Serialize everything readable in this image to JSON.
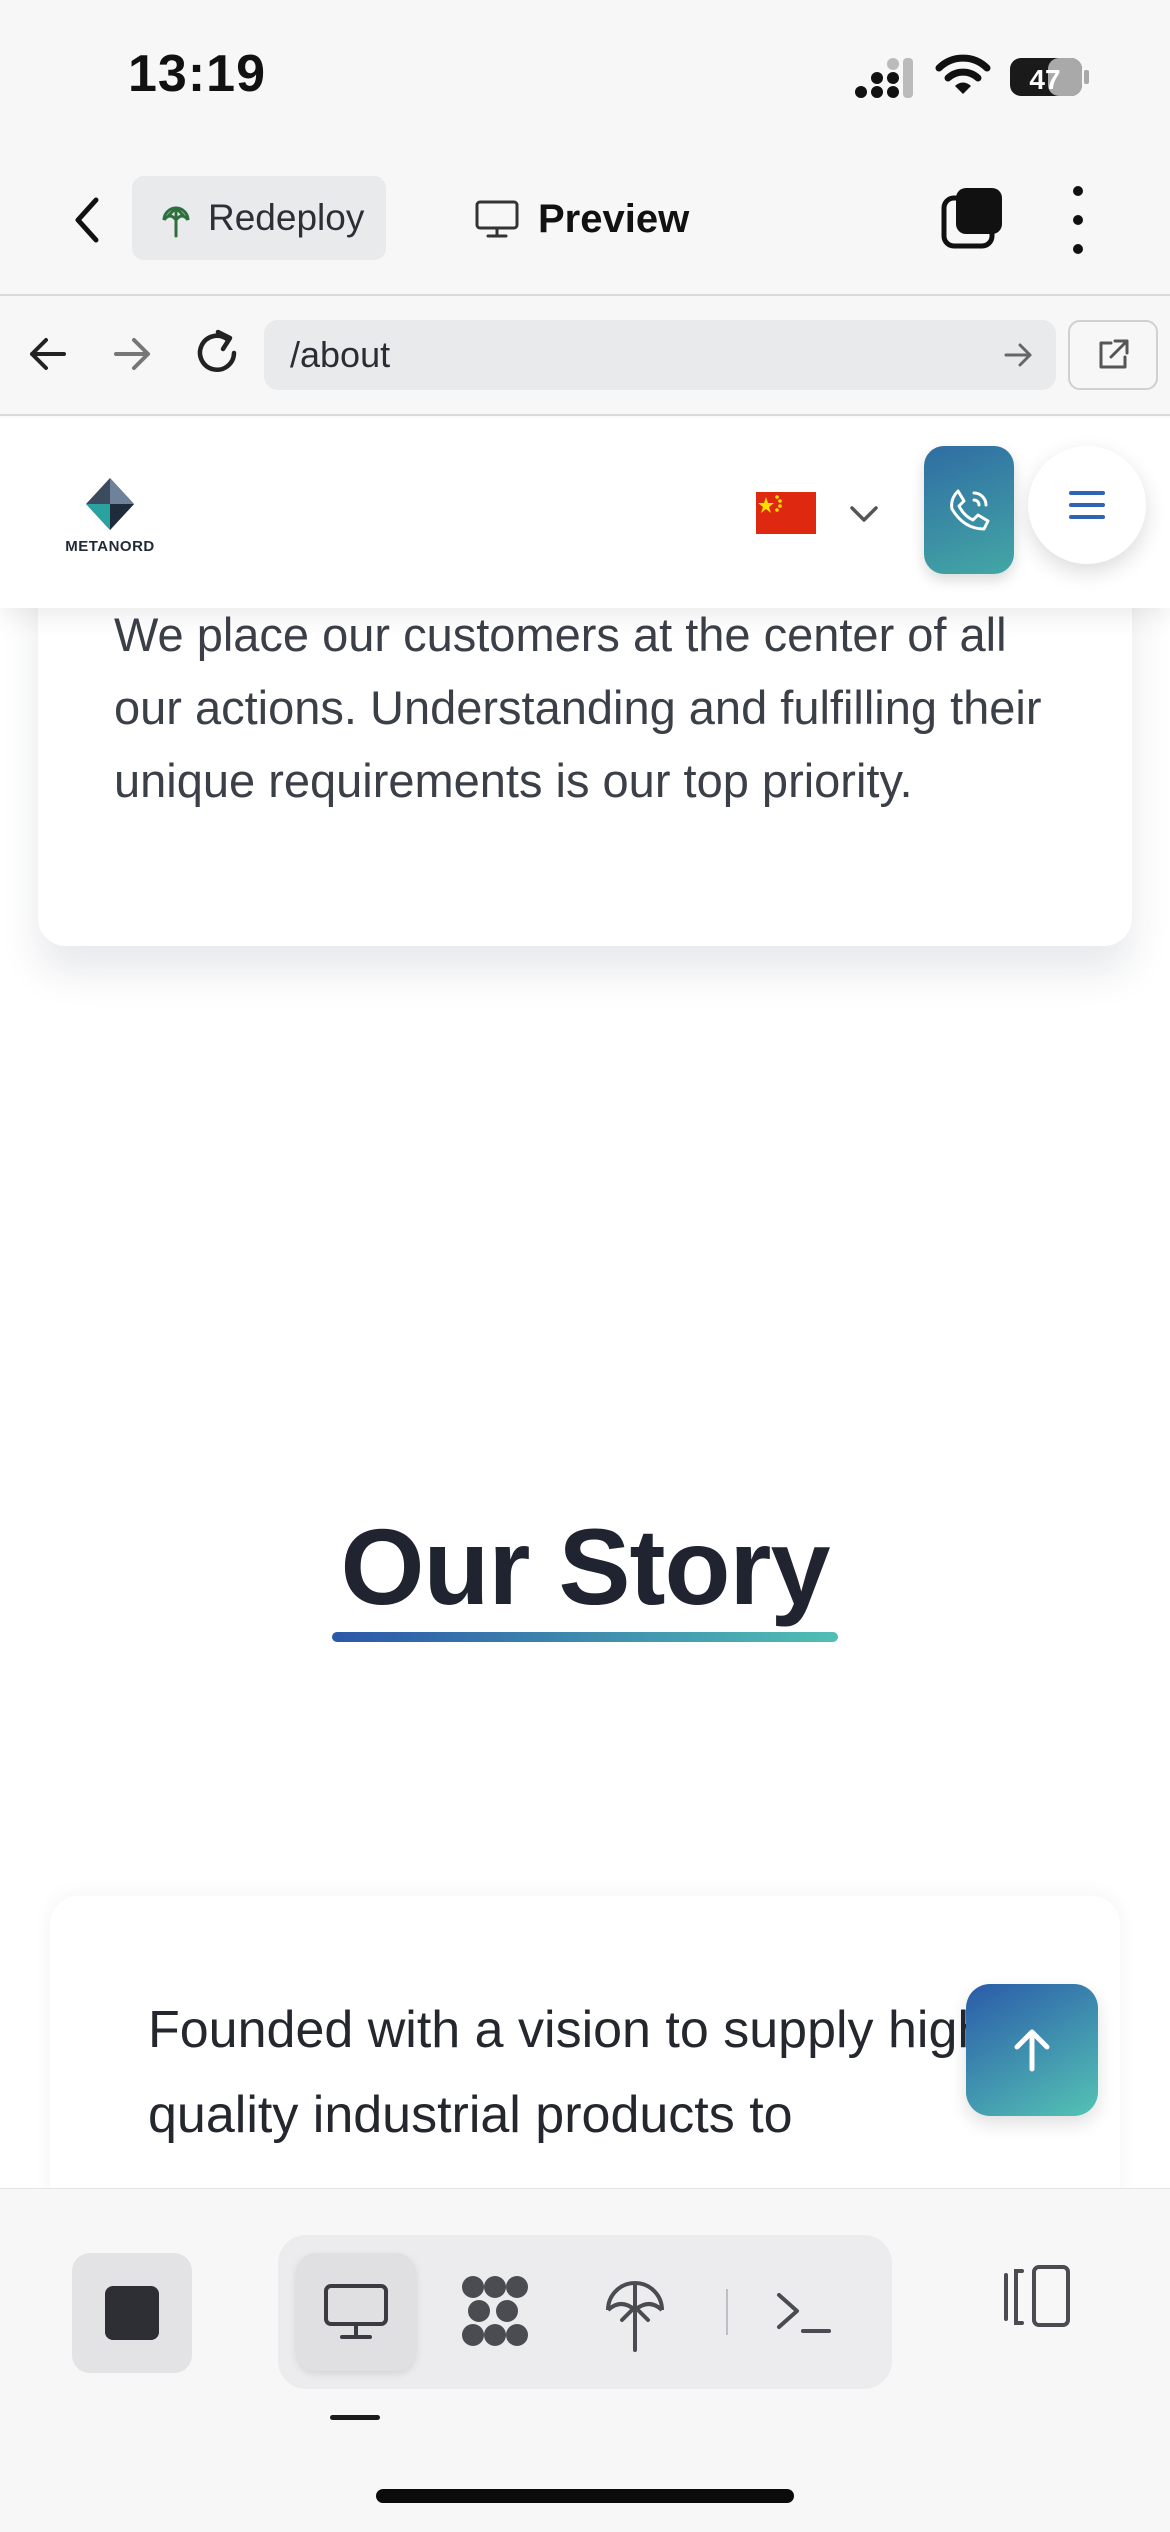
{
  "status_bar": {
    "time": "13:19",
    "battery": "47"
  },
  "toolbar": {
    "redeploy_label": "Redeploy",
    "preview_label": "Preview"
  },
  "browser": {
    "url": "/about"
  },
  "site": {
    "logo_text": "METANORD",
    "value_card_text": "We place our customers at the center of all our actions. Understanding and fulfilling their unique requirements is our top priority.",
    "story_title": "Our Story",
    "story_text": "Founded with a vision to supply high-quality industrial products to"
  },
  "colors": {
    "accent_blue": "#2c57a9",
    "accent_teal": "#4fbfb3",
    "flag_red": "#de2910",
    "flag_star": "#ffde00"
  },
  "icons": {
    "back": "chevron-left-icon",
    "redeploy": "redeploy-icon",
    "preview": "monitor-icon",
    "tabs": "tabs-icon",
    "more": "more-vertical-icon",
    "nav_back": "arrow-left-icon",
    "nav_forward": "arrow-right-icon",
    "reload": "reload-icon",
    "go": "arrow-right-icon",
    "open_external": "external-link-icon",
    "phone": "phone-icon",
    "menu": "hamburger-icon",
    "scroll_top": "arrow-up-icon",
    "stop": "stop-icon",
    "ai": "ai-agent-icon",
    "deploy": "deploy-icon",
    "console": "console-icon",
    "layout": "layout-toggle-icon"
  }
}
